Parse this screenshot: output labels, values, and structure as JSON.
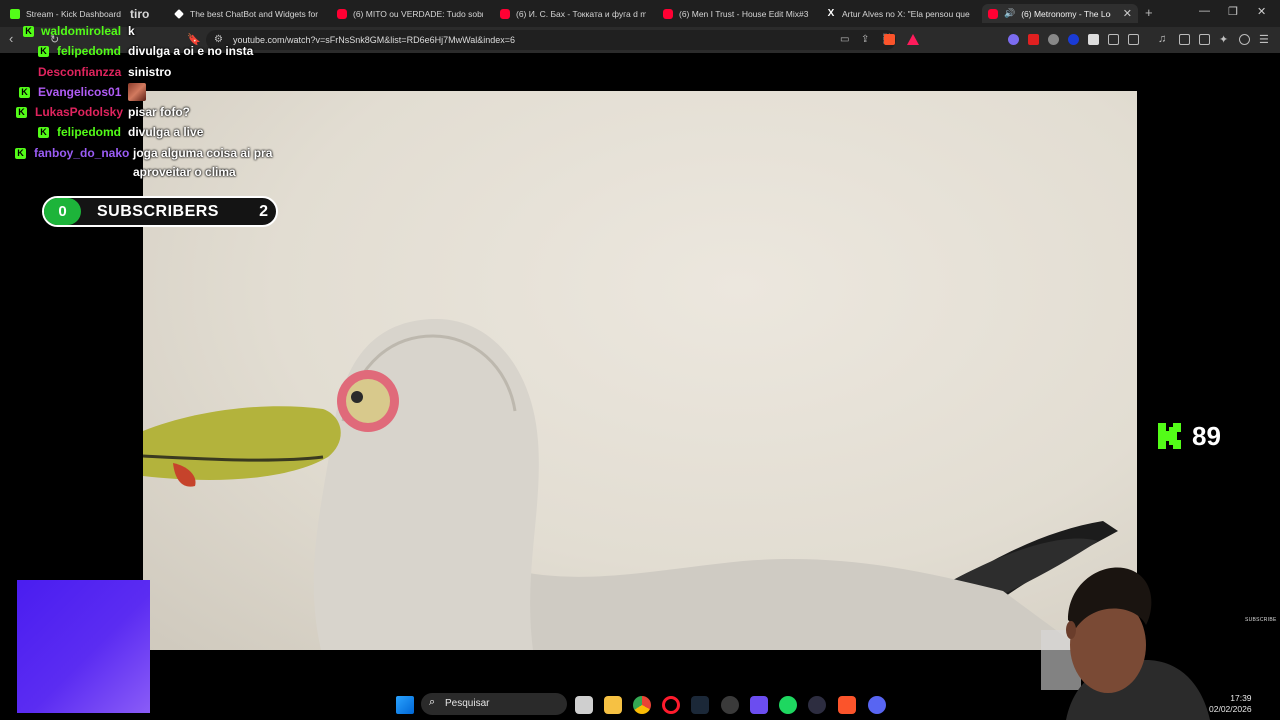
{
  "browser": {
    "tabs": [
      {
        "label": "Stream - Kick Dashboard",
        "icon": "kick-icon"
      },
      {
        "label": "tiro",
        "icon": ""
      },
      {
        "label": "The best ChatBot and Widgets for K",
        "icon": "diamond-icon"
      },
      {
        "label": "(6) MITO ou VERDADE: Tudo sobre o",
        "icon": "youtube-icon"
      },
      {
        "label": "(6) И. С. Бах - Токката и фуга d moll",
        "icon": "youtube-icon"
      },
      {
        "label": "(6) Men I Trust - House Edit Mix#3 -",
        "icon": "youtube-icon"
      },
      {
        "label": "Artur Alves no X: \"Ela pensou que tin",
        "icon": "x-icon"
      },
      {
        "label": "(6) Metronomy - The Look (C",
        "icon": "youtube-icon",
        "active": true
      }
    ],
    "url": "youtube.com/watch?v=sFrNsSnk8GM&list=RD6e6Hj7MwWal&index=6"
  },
  "chat": [
    {
      "user": "waldomiroleal",
      "color": "#53fc18",
      "text": "k"
    },
    {
      "user": "felipedomd",
      "color": "#53fc18",
      "text": "divulga a oi e no insta"
    },
    {
      "user": "Desconfianzza",
      "color": "#e0245e",
      "text": "sinistro"
    },
    {
      "user": "Evangelicos01",
      "color": "#b05cf5",
      "text": ""
    },
    {
      "user": "LukasPodolsky",
      "color": "#e0245e",
      "text": "pisar fofo?"
    },
    {
      "user": "felipedomd",
      "color": "#53fc18",
      "text": "divulga a live"
    },
    {
      "user": "fanboy_do_nako",
      "color": "#9a5cf5",
      "text": "joga alguma coisa ai pra",
      "text2": "aproveitar o clima"
    }
  ],
  "subs": {
    "current": "0",
    "label": "SUBSCRIBERS",
    "goal": "2"
  },
  "viewers": {
    "count": "89",
    "subscribe_label": "SUBSCRIBE"
  },
  "taskbar": {
    "search_placeholder": "Pesquisar",
    "time": "17:39",
    "date": "02/02/2026"
  },
  "colors": {
    "kick_green": "#53fc18",
    "purple": "#5b2cf2"
  }
}
